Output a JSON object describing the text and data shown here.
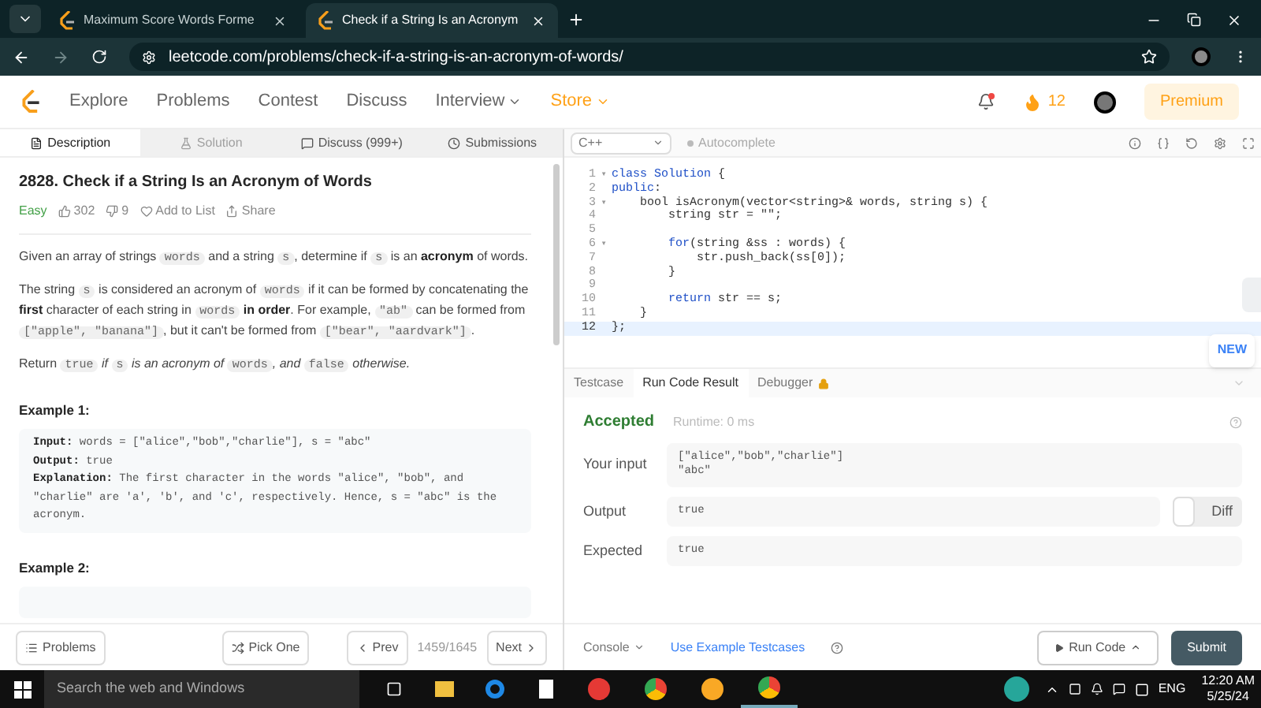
{
  "browser": {
    "tabs": [
      {
        "title": "Maximum Score Words Forme",
        "selected": false
      },
      {
        "title": "Check if a String Is an Acronym",
        "selected": true
      }
    ],
    "url": "leetcode.com/problems/check-if-a-string-is-an-acronym-of-words/"
  },
  "nav": {
    "items": [
      {
        "label": "Explore",
        "kind": "link"
      },
      {
        "label": "Problems",
        "kind": "link"
      },
      {
        "label": "Contest",
        "kind": "link"
      },
      {
        "label": "Discuss",
        "kind": "link"
      },
      {
        "label": "Interview",
        "kind": "menu"
      },
      {
        "label": "Store",
        "kind": "store"
      }
    ],
    "streak": "12",
    "premium": "Premium",
    "notification": true
  },
  "panel_tabs": [
    {
      "label": "Description",
      "selected": true,
      "disabled": false
    },
    {
      "label": "Solution",
      "selected": false,
      "disabled": true
    },
    {
      "label": "Discuss (999+)",
      "selected": false,
      "disabled": false
    },
    {
      "label": "Submissions",
      "selected": false,
      "disabled": false
    }
  ],
  "problem": {
    "title": "2828. Check if a String Is an Acronym of Words",
    "difficulty": "Easy",
    "likes": "302",
    "dislikes": "9",
    "add_to_list": "Add to List",
    "share": "Share",
    "paragraphs": [
      [
        {
          "kind": "text",
          "t": "Given an array of strings "
        },
        {
          "kind": "code",
          "t": "words"
        },
        {
          "kind": "text",
          "t": " and a string "
        },
        {
          "kind": "code",
          "t": "s"
        },
        {
          "kind": "text",
          "t": ", determine if "
        },
        {
          "kind": "code",
          "t": "s"
        },
        {
          "kind": "text",
          "t": " is an "
        },
        {
          "kind": "bold",
          "t": "acronym"
        },
        {
          "kind": "text",
          "t": " of words."
        }
      ],
      [
        {
          "kind": "text",
          "t": "The string "
        },
        {
          "kind": "code",
          "t": "s"
        },
        {
          "kind": "text",
          "t": " is considered an acronym of "
        },
        {
          "kind": "code",
          "t": "words"
        },
        {
          "kind": "text",
          "t": " if it can be formed by concatenating the "
        },
        {
          "kind": "bold",
          "t": "first"
        },
        {
          "kind": "text",
          "t": " character of each string in "
        },
        {
          "kind": "code",
          "t": "words"
        },
        {
          "kind": "bold",
          "t": " in order"
        },
        {
          "kind": "text",
          "t": ". For example, "
        },
        {
          "kind": "code",
          "t": "\"ab\""
        },
        {
          "kind": "text",
          "t": " can be formed from "
        },
        {
          "kind": "code",
          "t": "[\"apple\", \"banana\"]"
        },
        {
          "kind": "text",
          "t": ", but it can't be formed from "
        },
        {
          "kind": "code",
          "t": "[\"bear\", \"aardvark\"]"
        },
        {
          "kind": "text",
          "t": "."
        }
      ],
      [
        {
          "kind": "text",
          "t": "Return "
        },
        {
          "kind": "code",
          "t": "true"
        },
        {
          "kind": "italic",
          "t": " if "
        },
        {
          "kind": "code",
          "t": "s"
        },
        {
          "kind": "italic",
          "t": " is an acronym of "
        },
        {
          "kind": "code",
          "t": "words"
        },
        {
          "kind": "italic",
          "t": ", and "
        },
        {
          "kind": "code",
          "t": "false"
        },
        {
          "kind": "italic",
          "t": " otherwise."
        }
      ]
    ],
    "examples": [
      {
        "title": "Example 1:",
        "lines": [
          [
            {
              "kind": "bold",
              "t": "Input:"
            },
            {
              "kind": "text",
              "t": " words = [\"alice\",\"bob\",\"charlie\"], s = \"abc\""
            }
          ],
          [
            {
              "kind": "bold",
              "t": "Output:"
            },
            {
              "kind": "text",
              "t": " true"
            }
          ],
          [
            {
              "kind": "bold",
              "t": "Explanation:"
            },
            {
              "kind": "text",
              "t": " The first character in the words \"alice\", \"bob\", and \"charlie\" are 'a', 'b', and 'c', respectively. Hence, s = \"abc\" is the acronym."
            }
          ]
        ]
      },
      {
        "title": "Example 2:"
      }
    ]
  },
  "editor": {
    "language": "C++",
    "autocomplete": "Autocomplete",
    "new_badge": "NEW",
    "lines": [
      {
        "n": "1",
        "fold_mark": "▾",
        "current": false,
        "segs": [
          {
            "kind": "kw",
            "t": "class Solution"
          },
          {
            "kind": "txt",
            "t": " {"
          }
        ]
      },
      {
        "n": "2",
        "current": false,
        "segs": [
          {
            "kind": "kw",
            "t": "public"
          },
          {
            "kind": "txt",
            "t": ":"
          }
        ]
      },
      {
        "n": "3",
        "fold_mark": "▾",
        "current": false,
        "segs": [
          {
            "kind": "txt",
            "t": "    bool isAcronym(vector<string>& words, string s) {"
          }
        ]
      },
      {
        "n": "4",
        "current": false,
        "segs": [
          {
            "kind": "txt",
            "t": "        string str = \"\";"
          }
        ]
      },
      {
        "n": "5",
        "current": false
      },
      {
        "n": "6",
        "fold_mark": "▾",
        "current": false,
        "segs": [
          {
            "kind": "kw",
            "t": "        for"
          },
          {
            "kind": "txt",
            "t": "(string &ss : words) {"
          }
        ]
      },
      {
        "n": "7",
        "current": false,
        "segs": [
          {
            "kind": "txt",
            "t": "            str.push_back(ss[0]);"
          }
        ]
      },
      {
        "n": "8",
        "current": false,
        "segs": [
          {
            "kind": "txt",
            "t": "        }"
          }
        ]
      },
      {
        "n": "9",
        "current": false
      },
      {
        "n": "10",
        "current": false,
        "segs": [
          {
            "kind": "kw",
            "t": "        return"
          },
          {
            "kind": "txt",
            "t": " str == s;"
          }
        ]
      },
      {
        "n": "11",
        "current": false,
        "segs": [
          {
            "kind": "txt",
            "t": "    }"
          }
        ]
      },
      {
        "n": "12",
        "current": true,
        "segs": [
          {
            "kind": "txt",
            "t": "};"
          }
        ]
      }
    ]
  },
  "result_tabs": [
    {
      "label": "Testcase",
      "selected": false,
      "locked": false
    },
    {
      "label": "Run Code Result",
      "selected": true,
      "locked": false
    },
    {
      "label": "Debugger",
      "selected": false,
      "locked": true
    }
  ],
  "result": {
    "status": "Accepted",
    "runtime": "Runtime: 0 ms",
    "rows": [
      {
        "label": "Your input",
        "lines": [
          "[\"alice\",\"bob\",\"charlie\"]",
          "\"abc\""
        ],
        "kind": "plain"
      },
      {
        "label": "Output",
        "lines": [
          "true"
        ],
        "kind": "diff"
      },
      {
        "label": "Expected",
        "lines": [
          "true"
        ],
        "kind": "plain"
      }
    ],
    "diff": "Diff",
    "diff_on": false
  },
  "footer_left": {
    "problems": "Problems",
    "pick_one": "Pick One",
    "prev": "Prev",
    "position": "1459/1645",
    "next": "Next"
  },
  "footer_right": {
    "console": "Console",
    "example": "Use Example Testcases",
    "run": "Run Code",
    "submit": "Submit"
  },
  "taskbar": {
    "search": "Search the web and Windows",
    "time": "12:20 AM",
    "date": "5/25/24",
    "lang": "ENG"
  }
}
